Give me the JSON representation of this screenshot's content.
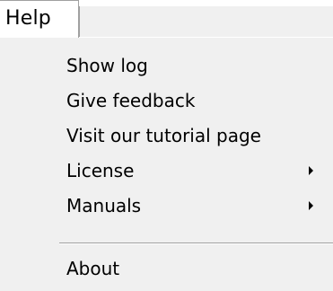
{
  "menubar": {
    "help_label": "Help"
  },
  "dropdown": {
    "items": [
      {
        "label": "Show log",
        "has_submenu": false
      },
      {
        "label": "Give feedback",
        "has_submenu": false
      },
      {
        "label": "Visit our tutorial page",
        "has_submenu": false
      },
      {
        "label": "License",
        "has_submenu": true
      },
      {
        "label": "Manuals",
        "has_submenu": true
      }
    ],
    "after_separator": [
      {
        "label": "About",
        "has_submenu": false
      }
    ],
    "submenu_icon": "triangle-right-icon"
  },
  "colors": {
    "menu_background": "#f0f0f0",
    "border": "#a0a0a0",
    "text": "#000000"
  }
}
